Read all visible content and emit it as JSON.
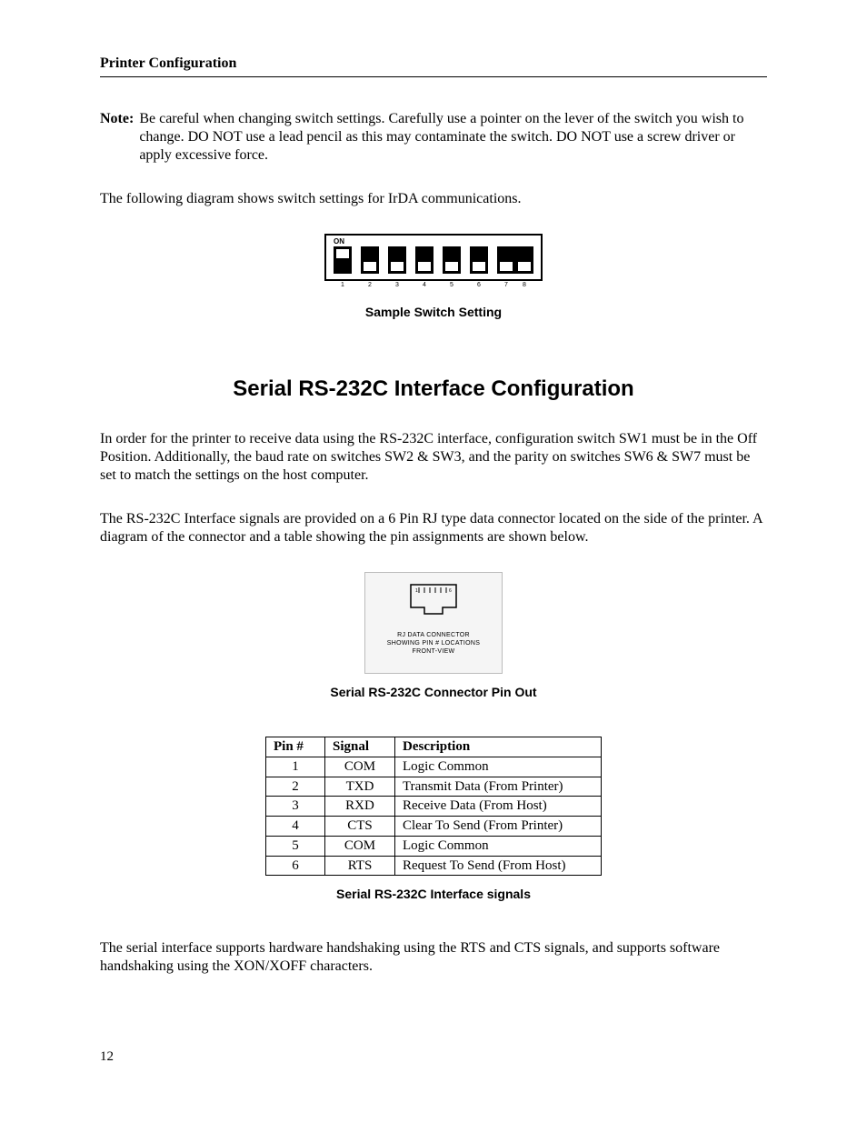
{
  "header": "Printer Configuration",
  "note_label": "Note:",
  "note_text": "Be careful when changing switch settings.  Carefully use a pointer on the lever of the switch you wish to change.  DO NOT use a lead pencil as this may contaminate the switch.  DO NOT use a screw driver or apply excessive force.",
  "intro_para": "The following diagram shows switch settings for IrDA communications.",
  "dip": {
    "on_label": "ON",
    "positions": [
      "1",
      "2",
      "3",
      "4",
      "5",
      "6",
      "7",
      "8"
    ],
    "states": [
      "on",
      "off",
      "off",
      "off",
      "off",
      "off",
      "off",
      "off"
    ],
    "caption": "Sample Switch Setting"
  },
  "section_title": "Serial RS-232C Interface Configuration",
  "serial_para1": "In order for the printer to receive data using the RS-232C interface, configuration switch SW1 must be in the Off Position.  Additionally, the baud rate on switches SW2 & SW3, and the parity on switches SW6 & SW7 must be set to match the settings on the host computer.",
  "serial_para2": "The RS-232C Interface signals are provided on a 6 Pin RJ type data connector located on the side of the printer.  A diagram of the connector and a table showing the pin assignments are shown below.",
  "connector": {
    "line1": "RJ DATA CONNECTOR",
    "line2": "SHOWING PIN # LOCATIONS",
    "line3": "FRONT-VIEW",
    "caption": "Serial RS-232C Connector Pin Out"
  },
  "table": {
    "headers": {
      "pin": "Pin #",
      "signal": "Signal",
      "desc": "Description"
    },
    "rows": [
      {
        "pin": "1",
        "signal": "COM",
        "desc": "Logic Common"
      },
      {
        "pin": "2",
        "signal": "TXD",
        "desc": "Transmit Data (From Printer)"
      },
      {
        "pin": "3",
        "signal": "RXD",
        "desc": "Receive Data (From Host)"
      },
      {
        "pin": "4",
        "signal": "CTS",
        "desc": "Clear To Send (From Printer)"
      },
      {
        "pin": "5",
        "signal": "COM",
        "desc": "Logic Common"
      },
      {
        "pin": "6",
        "signal": "RTS",
        "desc": "Request To Send (From Host)"
      }
    ],
    "caption": "Serial RS-232C Interface signals"
  },
  "closing_para": "The serial interface supports hardware handshaking using the RTS and CTS signals, and supports software handshaking using the XON/XOFF characters.",
  "page_number": "12"
}
